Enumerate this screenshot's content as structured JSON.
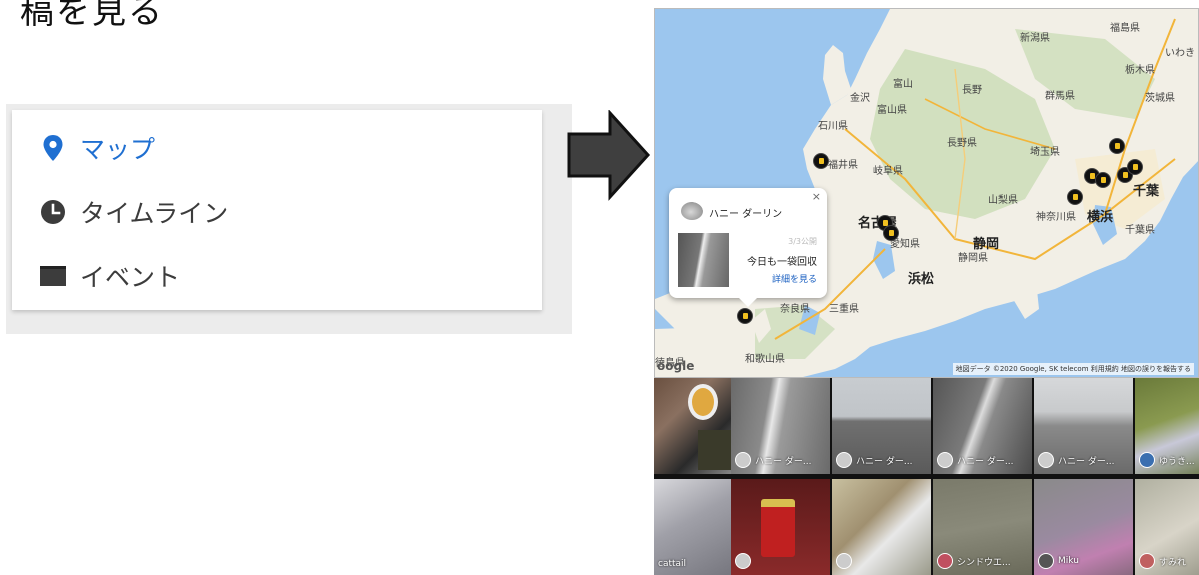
{
  "heading": "稿を見る",
  "menu": {
    "items": [
      {
        "label": "マップ",
        "icon": "map-pin-icon",
        "active": true,
        "color": "#1f6fd1"
      },
      {
        "label": "タイムライン",
        "icon": "clock-icon",
        "active": false,
        "color": "#3c3c3c"
      },
      {
        "label": "イベント",
        "icon": "event-card-icon",
        "active": false,
        "color": "#3c3c3c"
      }
    ]
  },
  "arrow": {
    "icon": "right-arrow-icon"
  },
  "map": {
    "labels": {
      "niigata": "新潟県",
      "fukushima": "福島県",
      "iwaki": "いわき",
      "tochigi": "栃木県",
      "ibaraki": "茨城県",
      "gunma": "群馬県",
      "nagano_city": "長野",
      "nagano": "長野県",
      "toyama_city": "富山",
      "kanazawa": "金沢",
      "toyama": "富山県",
      "ishikawa": "石川県",
      "gifu": "岐阜県",
      "fukui": "福井県",
      "saitama": "埼玉県",
      "yamanashi": "山梨県",
      "kanagawa": "神奈川県",
      "yokohama": "横浜",
      "chiba_city": "千葉",
      "chiba": "千葉県",
      "nagoya": "名古屋",
      "aichi": "愛知県",
      "shizuoka_city": "静岡",
      "shizuoka": "静岡県",
      "hamamatsu": "浜松",
      "nara": "奈良県",
      "mie": "三重県",
      "wakayama": "和歌山県",
      "tokushima": "徳島県"
    },
    "google": "oogle",
    "attribution": "地図データ ©2020 Google, SK telecom   利用規約   地図の誤りを報告する"
  },
  "popup": {
    "user": "ハニー ダーリン",
    "date": "3/3公開",
    "title": "今日も一袋回収",
    "link": "詳細を見る",
    "close": "×"
  },
  "grid": {
    "row1": [
      "",
      "ハニー ダー...",
      "ハニー ダー...",
      "ハニー ダー...",
      "ハニー ダー...",
      "ゆうき..."
    ],
    "row2": [
      "cattail",
      "",
      "",
      "シンドウエ...",
      "Miku",
      "すみれ"
    ]
  }
}
